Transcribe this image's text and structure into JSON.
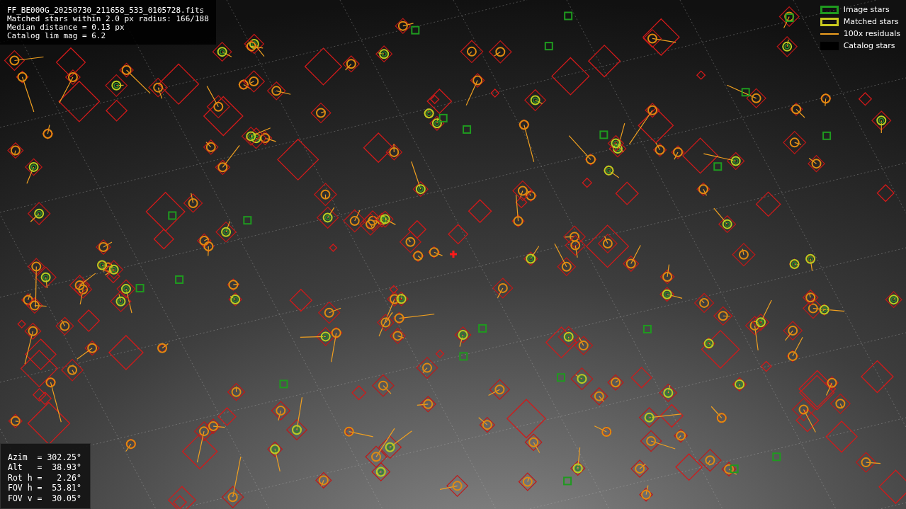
{
  "info": {
    "lines": [
      "FF_BE000G_20250730_211658_533_0105728.fits",
      "Matched stars within 2.0 px radius: 166/188",
      "Median distance = 0.13 px",
      "Catalog lim mag = 6.2"
    ]
  },
  "legend": [
    {
      "kind": "box",
      "color": "#1f9a1f",
      "label": "Image stars"
    },
    {
      "kind": "box",
      "color": "#c8c81e",
      "label": "Matched stars"
    },
    {
      "kind": "line",
      "color": "#f0a020",
      "label": "100x residuals"
    },
    {
      "kind": "none",
      "color": "#000000",
      "label": "Catalog stars"
    }
  ],
  "pointing": {
    "lines": [
      "Azim  = 302.25°",
      "Alt   =  38.93°",
      "Rot h =   2.26°",
      "FOV h =  53.81°",
      "FOV v =  30.05°"
    ]
  }
}
